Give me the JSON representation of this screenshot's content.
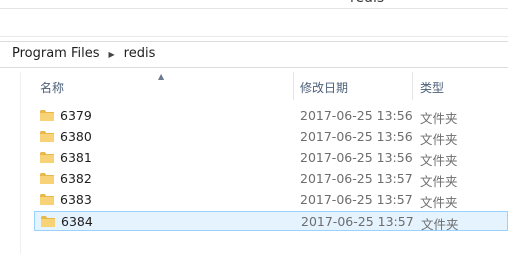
{
  "window": {
    "title": "redis"
  },
  "address": {
    "crumbs": [
      "Program Files",
      "redis"
    ]
  },
  "columns": {
    "name": "名称",
    "date": "修改日期",
    "type": "类型"
  },
  "files": [
    {
      "name": "6379",
      "date": "2017-06-25 13:56",
      "type": "文件夹"
    },
    {
      "name": "6380",
      "date": "2017-06-25 13:56",
      "type": "文件夹"
    },
    {
      "name": "6381",
      "date": "2017-06-25 13:56",
      "type": "文件夹"
    },
    {
      "name": "6382",
      "date": "2017-06-25 13:57",
      "type": "文件夹"
    },
    {
      "name": "6383",
      "date": "2017-06-25 13:57",
      "type": "文件夹"
    },
    {
      "name": "6384",
      "date": "2017-06-25 13:57",
      "type": "文件夹",
      "selected": true
    }
  ],
  "icons": {
    "folder": "folder-icon",
    "sort": "sort-up-icon",
    "separator": "chevron-right-icon"
  },
  "colors": {
    "folder": "#e8b84a",
    "selection_bg": "#e5f3ff",
    "selection_border": "#99d1ff"
  }
}
